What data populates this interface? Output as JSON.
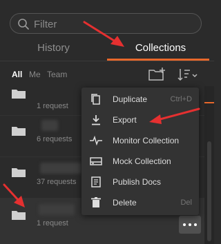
{
  "search": {
    "placeholder": "Filter",
    "icon": "search-icon"
  },
  "tabs": [
    {
      "label": "History"
    },
    {
      "label": "Collections"
    }
  ],
  "filter": {
    "all": "All",
    "me": "Me",
    "team": "Team"
  },
  "rows": [
    {
      "count": "1 request"
    },
    {
      "count": "6 requests"
    },
    {
      "count": "37 requests"
    },
    {
      "count": "1 request"
    }
  ],
  "menu": [
    {
      "label": "Duplicate",
      "shortcut": "Ctrl+D",
      "icon": "duplicate-icon"
    },
    {
      "label": "Export",
      "shortcut": "",
      "icon": "download-icon"
    },
    {
      "label": "Monitor Collection",
      "shortcut": "",
      "icon": "pulse-icon"
    },
    {
      "label": "Mock Collection",
      "shortcut": "",
      "icon": "server-icon"
    },
    {
      "label": "Publish Docs",
      "shortcut": "",
      "icon": "document-icon"
    },
    {
      "label": "Delete",
      "shortcut": "Del",
      "icon": "trash-icon"
    }
  ],
  "colors": {
    "accent": "#e8682b",
    "background": "#2b2b2b",
    "menu": "#333333",
    "arrow": "#e53030"
  }
}
